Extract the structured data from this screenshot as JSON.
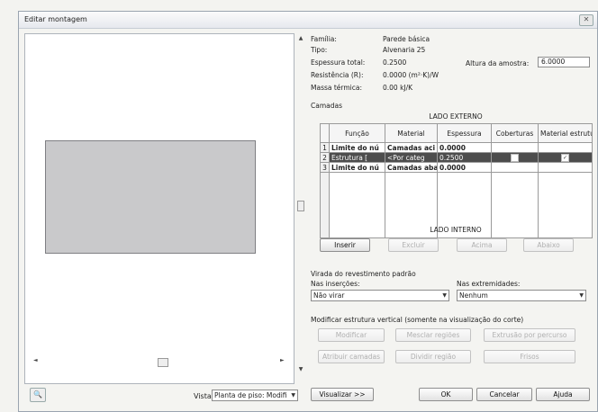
{
  "window": {
    "title": "Editar montagem",
    "close_glyph": "✕"
  },
  "properties": {
    "familia_label": "Família:",
    "familia_value": "Parede básica",
    "tipo_label": "Tipo:",
    "tipo_value": "Alvenaria 25",
    "espessura_label": "Espessura total:",
    "espessura_value": "0.2500",
    "resistencia_label": "Resistência (R):",
    "resistencia_value": "0.0000 (m²·K)/W",
    "massa_label": "Massa térmica:",
    "massa_value": "0.00 kJ/K",
    "altura_label": "Altura da amostra:",
    "altura_value": "6.0000"
  },
  "layers": {
    "section_label": "Camadas",
    "exterior_label": "LADO EXTERNO",
    "interior_label": "LADO INTERNO",
    "columns": [
      "Função",
      "Material",
      "Espessura",
      "Coberturas",
      "Material estrutural"
    ],
    "rows": [
      {
        "num": "1",
        "funcao": "Limite do nú",
        "material": "Camadas aci",
        "espessura": "0.0000"
      },
      {
        "num": "2",
        "funcao": "Estrutura [",
        "material": "<Por categ",
        "espessura": "0.2500"
      },
      {
        "num": "3",
        "funcao": "Limite do nú",
        "material": "Camadas abai",
        "espessura": "0.0000"
      }
    ],
    "check_glyph": "✓"
  },
  "layer_buttons": {
    "inserir": "Inserir",
    "excluir": "Excluir",
    "acima": "Acima",
    "abaixo": "Abaixo"
  },
  "wrap": {
    "title": "Virada do revestimento padrão",
    "insercoes_label": "Nas inserções:",
    "insercoes_value": "Não virar",
    "extremidades_label": "Nas extremidades:",
    "extremidades_value": "Nenhum"
  },
  "vertical": {
    "title": "Modificar estrutura vertical (somente na visualização do corte)",
    "modificar": "Modificar",
    "mesclar": "Mesclar regiões",
    "extrusao": "Extrusão por percurso",
    "atribuir": "Atribuir camadas",
    "dividir": "Dividir região",
    "frisos": "Frisos"
  },
  "footer": {
    "vista_label": "Vista:",
    "vista_value": "Planta de piso: Modifi",
    "visualizar": "Visualizar >>",
    "ok": "OK",
    "cancelar": "Cancelar",
    "ajuda": "Ajuda"
  },
  "icons": {
    "dropdown": "▼",
    "zoom": "🔍",
    "up": "▲",
    "down": "▼",
    "left": "◄",
    "right": "►"
  }
}
